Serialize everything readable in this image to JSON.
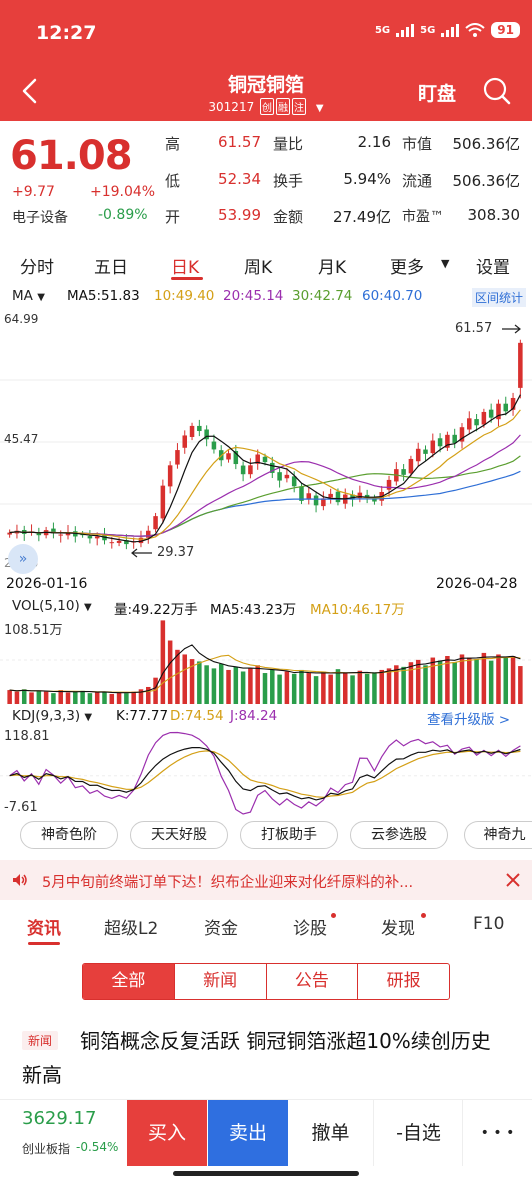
{
  "status_bar": {
    "time": "12:27",
    "signal1": "5G",
    "signal2": "5G",
    "battery": "91"
  },
  "header": {
    "title": "铜冠铜箔",
    "code": "301217",
    "tags": [
      "创",
      "融",
      "注"
    ],
    "watch_label": "盯盘",
    "bg_color": "#e63f3c"
  },
  "quote": {
    "price": "61.08",
    "change": "+9.77",
    "change_pct": "+19.04%",
    "industry": "电子设备",
    "industry_pct": "-0.89%",
    "rows": [
      {
        "l1": "高",
        "v1": "61.57",
        "l2": "量比",
        "v2": "2.16",
        "l3": "市值",
        "v3": "506.36亿"
      },
      {
        "l1": "低",
        "v1": "52.34",
        "l2": "换手",
        "v2": "5.94%",
        "l3": "流通",
        "v3": "506.36亿"
      },
      {
        "l1": "开",
        "v1": "53.99",
        "l2": "金额",
        "v2": "27.49亿",
        "l3": "市盈™",
        "v3": "308.30"
      }
    ],
    "up_color": "#d8302e",
    "down_color": "#2a9d4a"
  },
  "period_tabs": {
    "items": [
      "分时",
      "五日",
      "日K",
      "周K",
      "月K",
      "更多",
      "设置"
    ],
    "active": "日K"
  },
  "ma_legend": {
    "label": "MA",
    "ma5": "MA5:51.83",
    "ma10": "10:49.40",
    "ma20": "20:45.14",
    "ma30": "30:42.74",
    "ma60": "60:40.70",
    "stats_button": "区间统计",
    "colors": {
      "ma5": "#111111",
      "ma10": "#d4a017",
      "ma20": "#9b2fae",
      "ma30": "#5a9e2f",
      "ma60": "#2f6fd6"
    }
  },
  "chart_data": [
    {
      "type": "candlestick",
      "title": "",
      "y_max_label": "64.99",
      "y_mid_label": "45.47",
      "y_min_label": "25.95",
      "ylim": [
        25.95,
        64.99
      ],
      "x_start": "2026-01-16",
      "x_end": "2026-04-28",
      "high_marker": "61.57",
      "low_marker": "29.37",
      "closes": [
        31.2,
        31.5,
        31.0,
        31.4,
        30.8,
        31.6,
        31.1,
        30.9,
        31.3,
        30.6,
        30.9,
        30.3,
        30.6,
        30.0,
        29.7,
        29.9,
        29.4,
        29.8,
        30.4,
        31.5,
        33.8,
        38.6,
        41.8,
        44.2,
        46.5,
        48.0,
        47.2,
        45.9,
        44.3,
        42.6,
        43.7,
        42.0,
        40.4,
        41.8,
        43.5,
        42.3,
        40.6,
        39.4,
        40.3,
        38.5,
        36.2,
        37.4,
        35.5,
        36.6,
        37.3,
        36.0,
        37.2,
        36.4,
        37.5,
        36.8,
        36.1,
        37.6,
        39.5,
        41.2,
        40.3,
        42.8,
        44.4,
        43.6,
        45.7,
        44.8,
        46.6,
        45.3,
        47.8,
        49.2,
        48.1,
        50.2,
        49.3,
        51.5,
        50.3,
        52.4,
        61.08
      ]
    },
    {
      "type": "bar",
      "title": "VOL(5,10)",
      "legend": {
        "vol": "量:49.22万手",
        "ma5": "MA5:43.23万",
        "ma10": "MA10:46.17万"
      },
      "y_max_label": "108.51万",
      "ylim": [
        0,
        108.51
      ],
      "values": [
        18,
        16,
        19,
        15,
        17,
        16,
        14,
        18,
        15,
        16,
        17,
        14,
        15,
        16,
        13,
        15,
        14,
        16,
        19,
        22,
        34,
        108,
        82,
        70,
        64,
        58,
        55,
        50,
        46,
        52,
        44,
        48,
        42,
        46,
        50,
        40,
        44,
        38,
        42,
        39,
        44,
        40,
        36,
        42,
        38,
        45,
        40,
        37,
        43,
        39,
        41,
        44,
        46,
        50,
        48,
        54,
        57,
        50,
        60,
        56,
        62,
        54,
        64,
        60,
        58,
        66,
        56,
        64,
        60,
        62,
        49
      ]
    },
    {
      "type": "line",
      "title": "KDJ(9,3,3)",
      "legend": {
        "k": "K:77.77",
        "d": "D:74.54",
        "j": "J:84.24"
      },
      "y_max_label": "118.81",
      "y_min_label": "-7.61",
      "ylim": [
        -7.61,
        118.81
      ],
      "link": "查看升级版 >"
    }
  ],
  "feature_buttons": [
    "神奇色阶",
    "天天好股",
    "打板助手",
    "云参选股",
    "神奇九"
  ],
  "ticker": {
    "text": "5月中旬前终端订单下达！织布企业迎来对化纤原料的补..."
  },
  "section_tabs": [
    "资讯",
    "超级L2",
    "资金",
    "诊股",
    "发现",
    "F10"
  ],
  "segment_tabs": [
    "全部",
    "新闻",
    "公告",
    "研报"
  ],
  "news": {
    "tag": "新闻",
    "headline": "铜箔概念反复活跃 铜冠铜箔涨超10%续创历史新高"
  },
  "bottom_bar": {
    "index_value": "3629.17",
    "index_name": "创业板指",
    "index_pct": "-0.54%",
    "buy": "买入",
    "sell": "卖出",
    "cancel": "撤单",
    "watchlist": "-自选",
    "more": "• • •"
  }
}
